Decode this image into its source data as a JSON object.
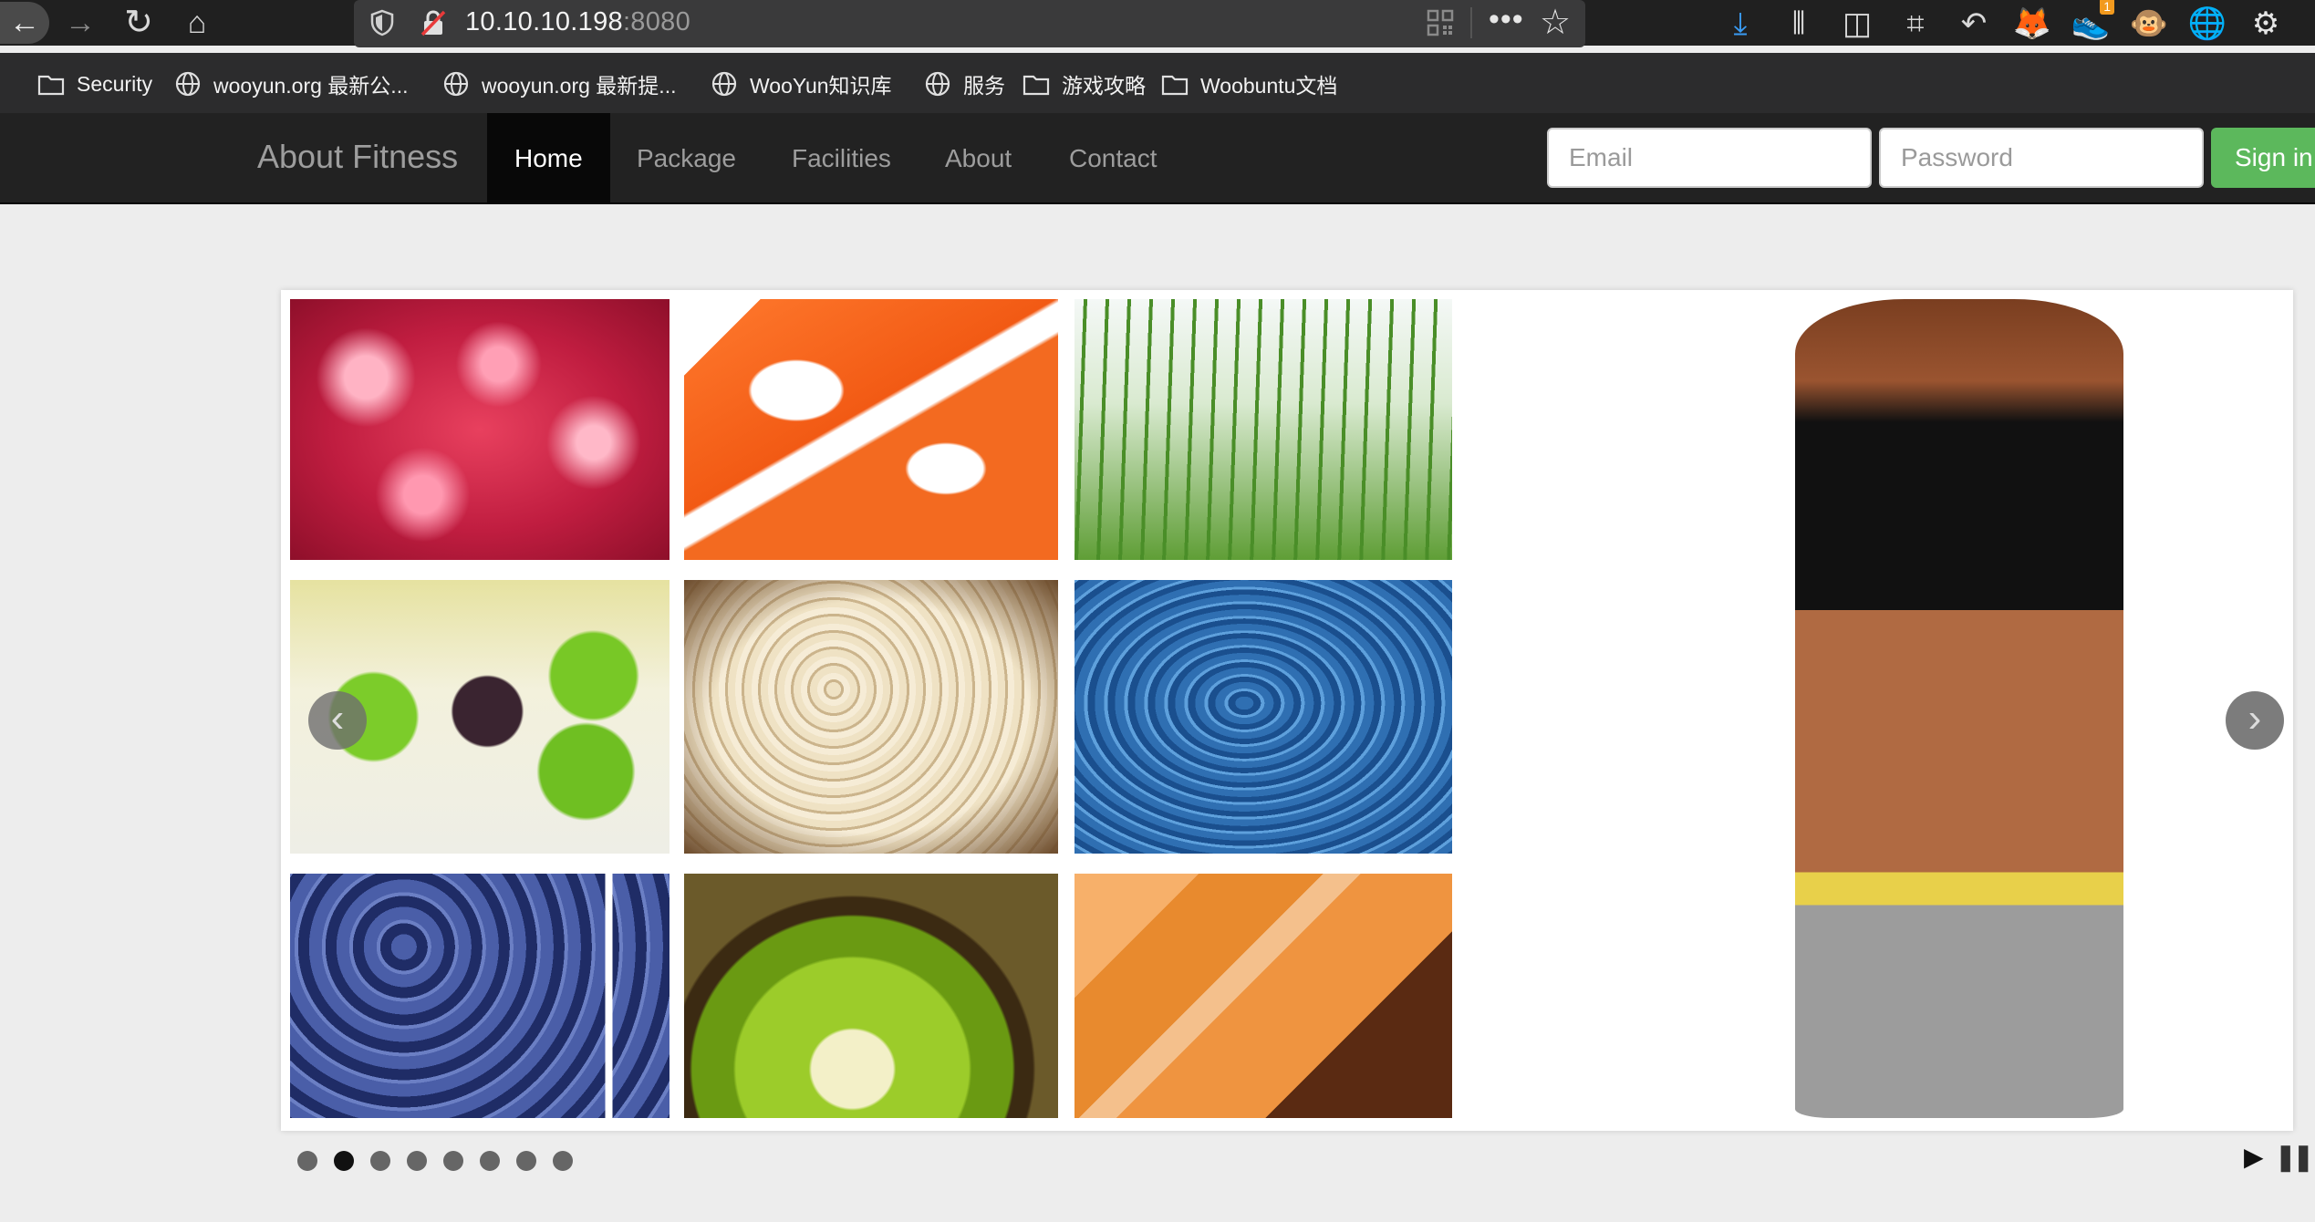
{
  "browser": {
    "url_host": "10.10.10.198",
    "url_port": ":8080",
    "more_label": "•••",
    "star_label": "☆",
    "back_label": "←",
    "forward_label": "→",
    "reload_label": "↻",
    "home_label": "⌂",
    "extensions": [
      {
        "name": "download-icon",
        "glyph": "⤓",
        "color": "#3a9cf5"
      },
      {
        "name": "library-icon",
        "glyph": "⫴",
        "color": "#d8d8d8"
      },
      {
        "name": "sidebar-icon",
        "glyph": "◫",
        "color": "#d8d8d8"
      },
      {
        "name": "crop-icon",
        "glyph": "⌗",
        "color": "#d8d8d8"
      },
      {
        "name": "undo-icon",
        "glyph": "↶",
        "color": "#d8d8d8"
      },
      {
        "name": "fox-extension-icon",
        "glyph": "🦊",
        "color": "#e8822a"
      },
      {
        "name": "sneaker-extension-icon",
        "glyph": "👟",
        "color": "#ffffff"
      },
      {
        "name": "monkey-extension-icon",
        "glyph": "🐵",
        "color": "#c08a4a"
      },
      {
        "name": "globe-extension-icon",
        "glyph": "🌐",
        "color": "#4a7ad8"
      },
      {
        "name": "gear-icon",
        "glyph": "⚙",
        "color": "#e6e6e6"
      }
    ],
    "badge_count": "1"
  },
  "bookmarks": [
    {
      "label": "Security",
      "icon": "folder-icon"
    },
    {
      "label": "wooyun.org 最新公...",
      "icon": "globe-icon"
    },
    {
      "label": "wooyun.org 最新提...",
      "icon": "globe-icon"
    },
    {
      "label": "WooYun知识库",
      "icon": "globe-icon"
    },
    {
      "label": "服务",
      "icon": "globe-icon"
    },
    {
      "label": "游戏攻略",
      "icon": "folder-icon"
    },
    {
      "label": "Woobuntu文档",
      "icon": "folder-icon"
    }
  ],
  "navbar": {
    "brand": "About Fitness",
    "items": [
      {
        "label": "Home",
        "active": true
      },
      {
        "label": "Package",
        "active": false
      },
      {
        "label": "Facilities",
        "active": false
      },
      {
        "label": "About",
        "active": false
      },
      {
        "label": "Contact",
        "active": false
      }
    ],
    "email_placeholder": "Email",
    "password_placeholder": "Password",
    "signin_label": "Sign in"
  },
  "carousel": {
    "prev_label": "‹",
    "next_label": "›",
    "slide_count": 8,
    "active_slide": 2,
    "play_label": "▶",
    "pause_label": "❚❚"
  },
  "colors": {
    "navbar_bg": "#222222",
    "signin_green": "#5cb85c",
    "page_bg": "#ededed"
  }
}
